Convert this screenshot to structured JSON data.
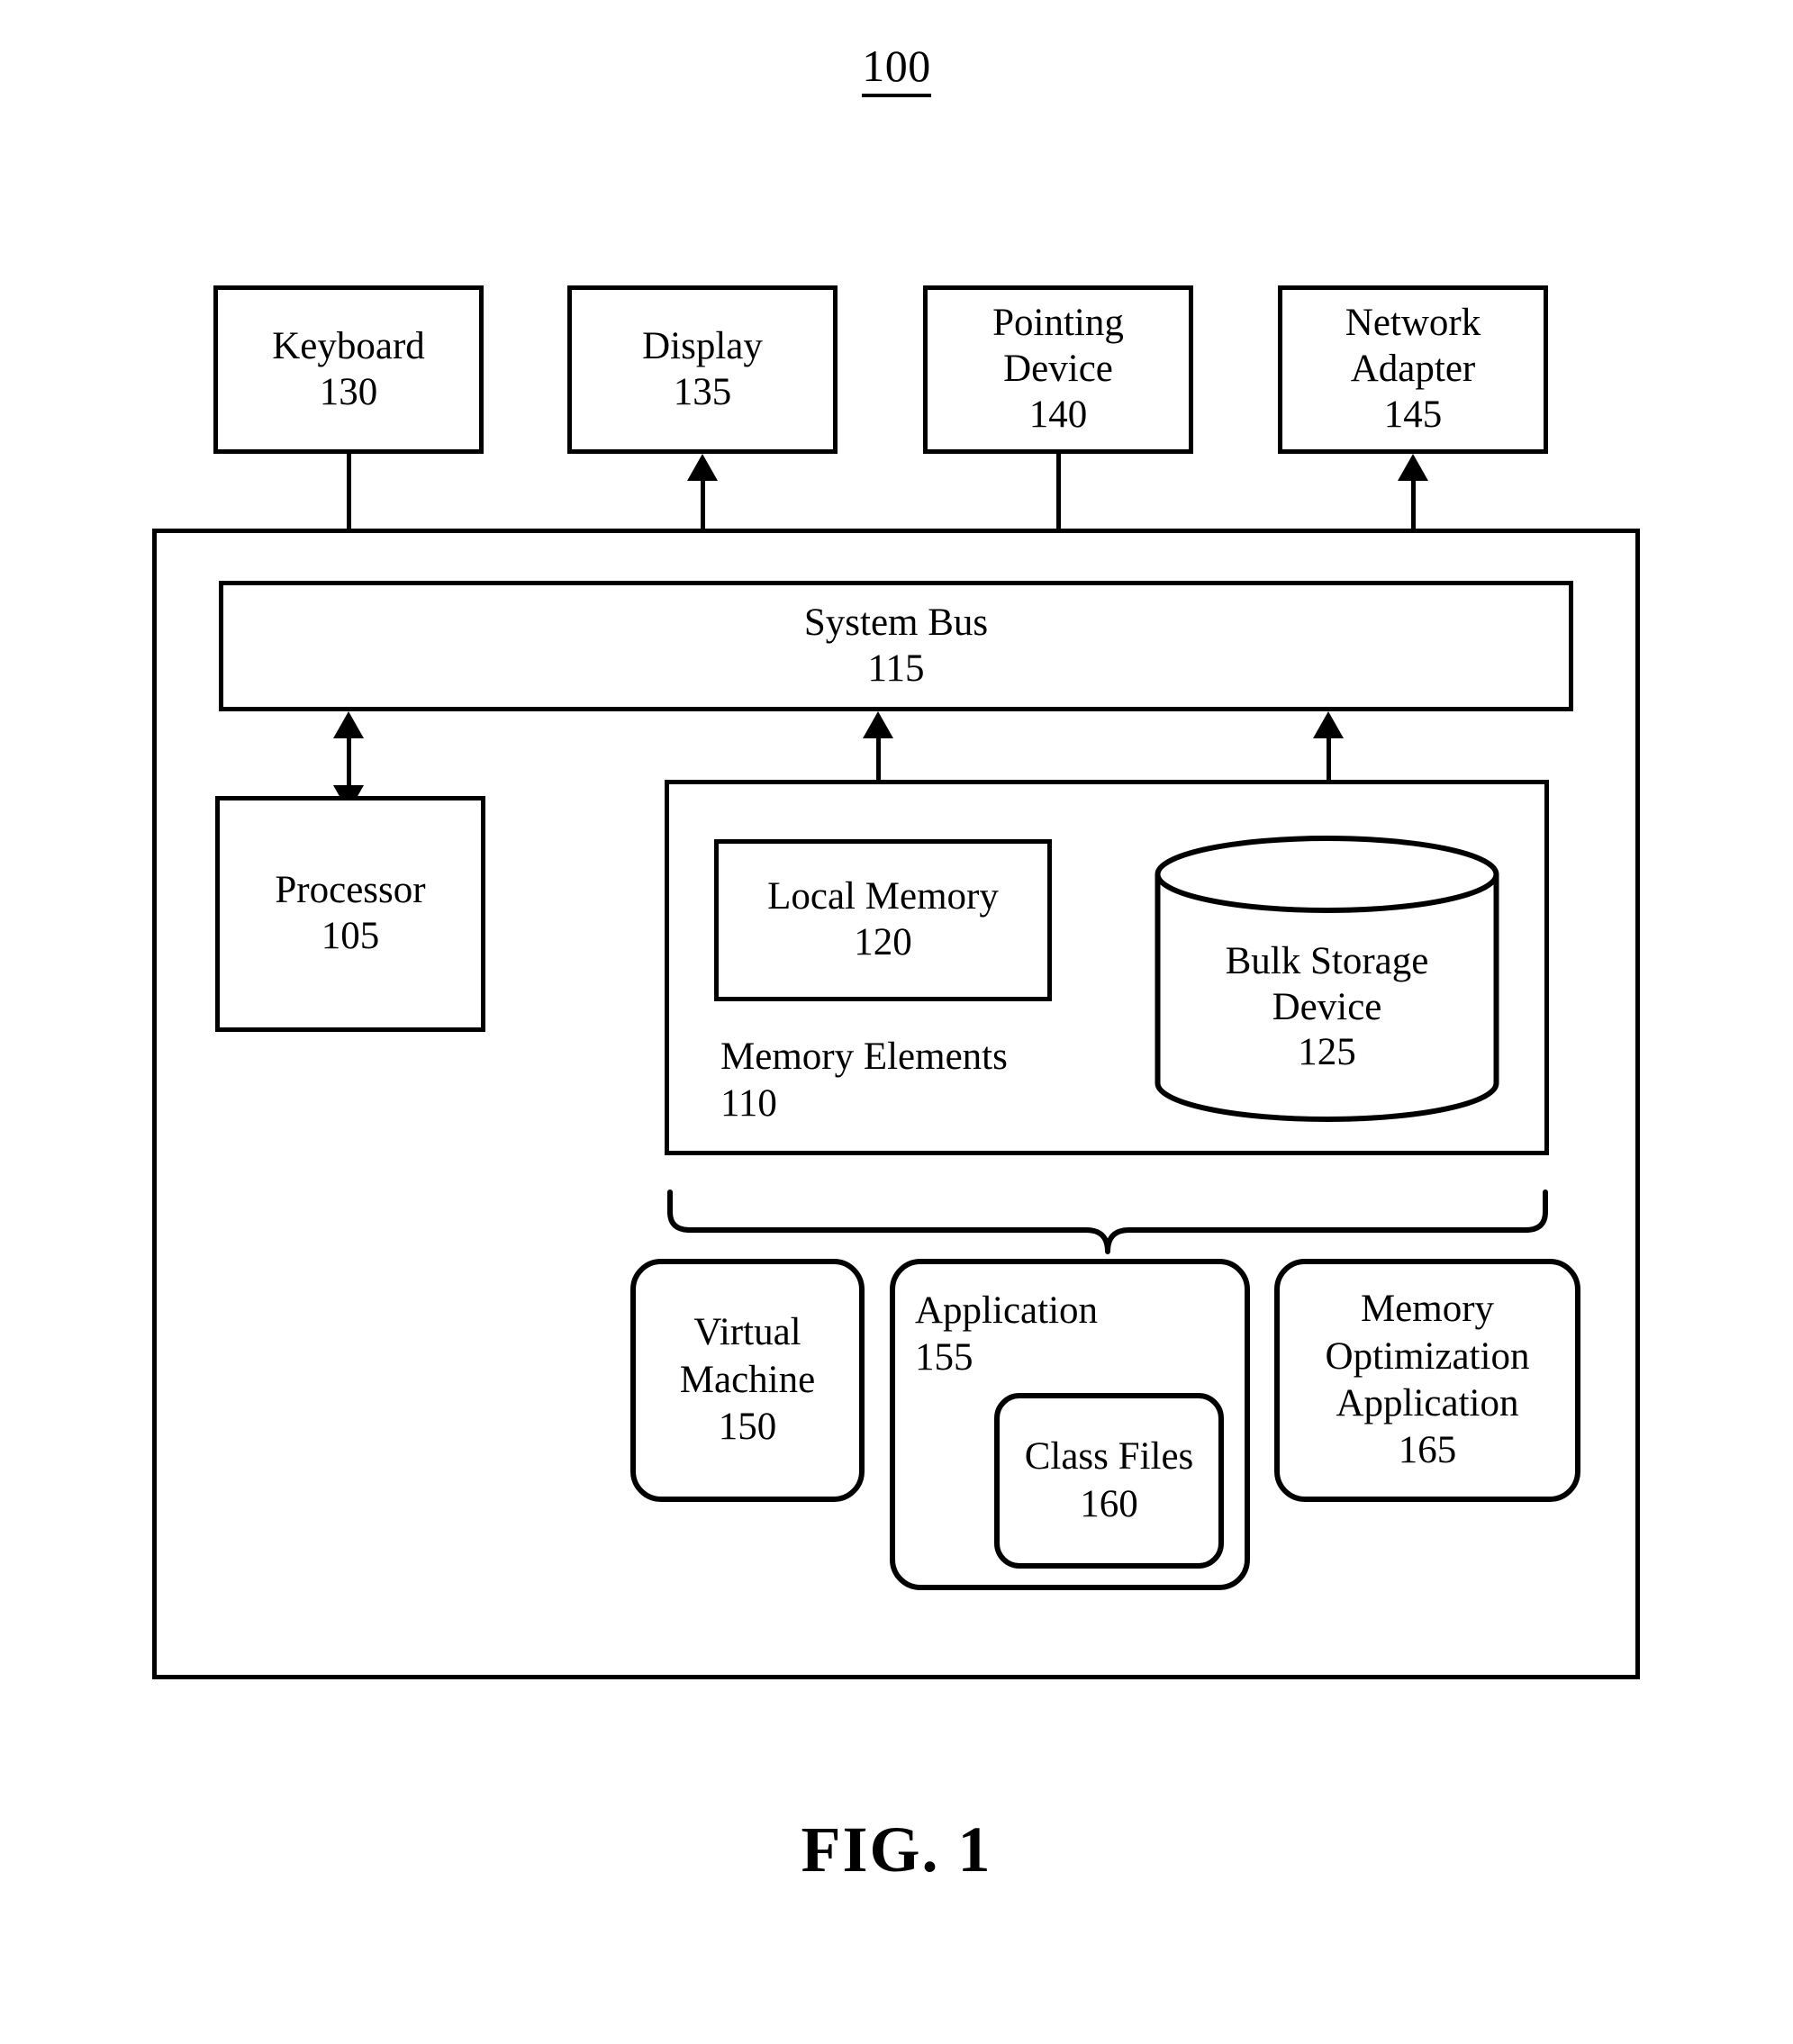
{
  "figure": {
    "reference_numeral": "100",
    "caption": "FIG. 1"
  },
  "peripherals": [
    {
      "name": "keyboard",
      "label": "Keyboard",
      "numeral": "130",
      "arrow": "down"
    },
    {
      "name": "display",
      "label": "Display",
      "numeral": "135",
      "arrow": "up"
    },
    {
      "name": "pointing-device",
      "label_line1": "Pointing",
      "label_line2": "Device",
      "numeral": "140",
      "arrow": "down"
    },
    {
      "name": "network-adapter",
      "label_line1": "Network",
      "label_line2": "Adapter",
      "numeral": "145",
      "arrow": "both"
    }
  ],
  "system_bus": {
    "label": "System Bus",
    "numeral": "115"
  },
  "processor": {
    "label": "Processor",
    "numeral": "105"
  },
  "memory_elements": {
    "label": "Memory Elements",
    "numeral": "110",
    "local_memory": {
      "label": "Local Memory",
      "numeral": "120"
    },
    "bulk_storage": {
      "label_line1": "Bulk Storage",
      "label_line2": "Device",
      "numeral": "125"
    }
  },
  "software": {
    "virtual_machine": {
      "label_line1": "Virtual",
      "label_line2": "Machine",
      "numeral": "150"
    },
    "application": {
      "label": "Application",
      "numeral": "155",
      "class_files": {
        "label": "Class Files",
        "numeral": "160"
      }
    },
    "memory_optimization_application": {
      "label_line1": "Memory",
      "label_line2": "Optimization",
      "label_line3": "Application",
      "numeral": "165"
    }
  },
  "colors": {
    "stroke": "#000000",
    "background": "#ffffff"
  }
}
